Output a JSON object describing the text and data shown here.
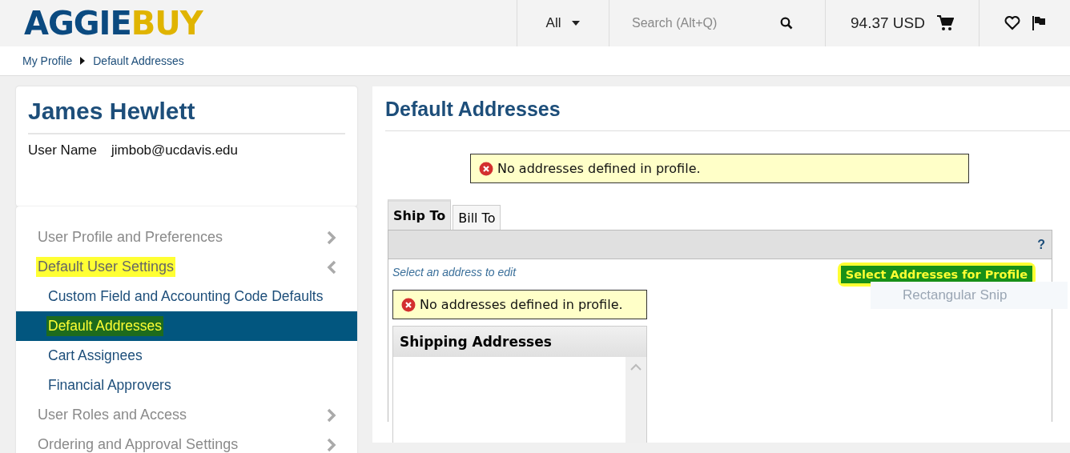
{
  "header": {
    "logo": {
      "part_1": "AGGIE",
      "part_2": "BUY"
    },
    "scope": "All",
    "search": {
      "placeholder": "Search (Alt+Q)"
    },
    "cart_total": "94.37 USD"
  },
  "breadcrumb": [
    {
      "label": "My Profile"
    },
    {
      "label": "Default Addresses"
    }
  ],
  "profile": {
    "name": "James Hewlett",
    "user_name_label": "User Name",
    "user_name": "jimbob@ucdavis.edu"
  },
  "nav": [
    {
      "label": "User Profile and Preferences",
      "expanded": false,
      "highlighted": false
    },
    {
      "label": "Default User Settings",
      "expanded": true,
      "highlighted": true,
      "children": [
        {
          "label": "Custom Field and Accounting Code Defaults",
          "selected": false,
          "highlighted": false
        },
        {
          "label": "Default Addresses",
          "selected": true,
          "highlighted": true
        },
        {
          "label": "Cart Assignees",
          "selected": false,
          "highlighted": false
        },
        {
          "label": "Financial Approvers",
          "selected": false,
          "highlighted": false
        }
      ]
    },
    {
      "label": "User Roles and Access",
      "expanded": false,
      "highlighted": false
    },
    {
      "label": "Ordering and Approval Settings",
      "expanded": false,
      "highlighted": false
    }
  ],
  "main": {
    "title": "Default Addresses",
    "message": {
      "kind": "error",
      "text": "No addresses defined in profile."
    },
    "tabs": [
      {
        "label": "Ship To",
        "selected": true
      },
      {
        "label": "Bill To",
        "selected": false
      }
    ],
    "help": "?",
    "hint": "Select an address to edit",
    "select_button": {
      "label": "Select Addresses for Profile",
      "highlighted": true
    },
    "tooltip": "Rectangular Snip",
    "inner_message": {
      "kind": "error",
      "text": "No addresses defined in profile."
    },
    "list_title": "Shipping Addresses"
  }
}
